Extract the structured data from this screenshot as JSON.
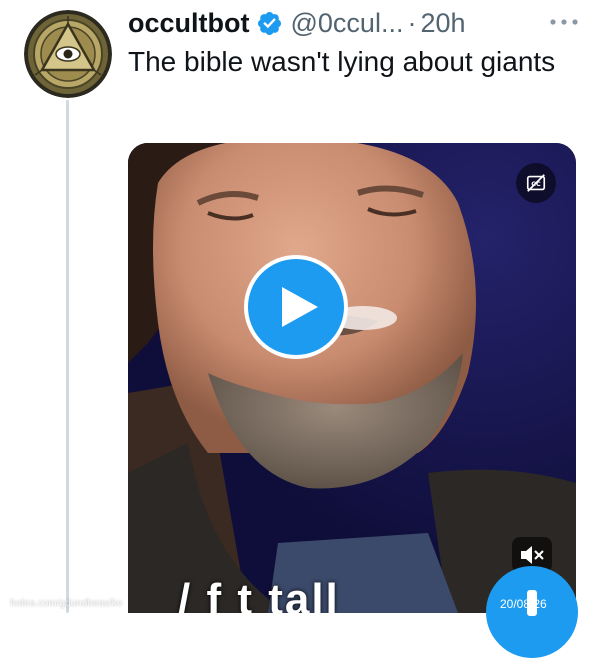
{
  "tweet": {
    "display_name": "occultbot",
    "handle": "@0ccul...",
    "separator": "·",
    "time": "20h",
    "text": "The bible wasn't lying about giants",
    "verified": true
  },
  "video": {
    "caption": "/ f  t  tall",
    "cc_icon": "captions-off-icon",
    "play_icon": "play-icon",
    "mute_icon": "volume-muted-icon"
  },
  "watermark": {
    "left": "fodea.com/gdundbeas/ko",
    "date": "20/08/26"
  },
  "colors": {
    "accent": "#1d9bf0",
    "text_primary": "#0f1419",
    "text_secondary": "#536471",
    "thread_line": "#cfd9de"
  }
}
